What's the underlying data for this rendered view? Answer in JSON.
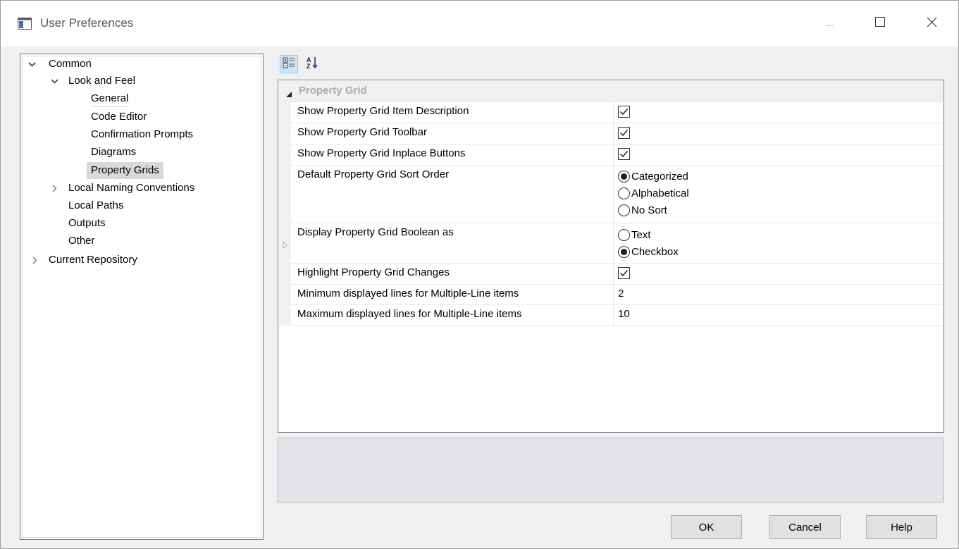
{
  "window": {
    "title": "User Preferences",
    "controls": {
      "minimize": "minimize-icon",
      "maximize": "maximize-icon",
      "close": "close-icon"
    }
  },
  "tree": {
    "common": "Common",
    "look_and_feel": "Look and Feel",
    "general": "General",
    "code_editor": "Code Editor",
    "confirmation_prompts": "Confirmation Prompts",
    "diagrams": "Diagrams",
    "property_grids": "Property Grids",
    "local_naming_conventions": "Local Naming Conventions",
    "local_paths": "Local Paths",
    "outputs": "Outputs",
    "other": "Other",
    "current_repository": "Current Repository",
    "selected": "Property Grids"
  },
  "toolbar": {
    "categorized_icon": "categorized-icon",
    "alphabetical_icon": "sort-az-icon"
  },
  "grid": {
    "category": "Property Grid",
    "rows": [
      {
        "name": "Show Property Grid Item Description",
        "type": "checkbox",
        "checked": true
      },
      {
        "name": "Show Property Grid Toolbar",
        "type": "checkbox",
        "checked": true
      },
      {
        "name": "Show Property Grid Inplace Buttons",
        "type": "checkbox",
        "checked": true
      },
      {
        "name": "Default Property Grid Sort Order",
        "type": "radio",
        "options": [
          "Categorized",
          "Alphabetical",
          "No Sort"
        ],
        "selected": "Categorized"
      },
      {
        "name": "Display Property Grid Boolean as",
        "type": "radio",
        "options": [
          "Text",
          "Checkbox"
        ],
        "selected": "Checkbox"
      },
      {
        "name": "Highlight Property Grid Changes",
        "type": "checkbox",
        "checked": true
      },
      {
        "name": "Minimum displayed lines for Multiple-Line items",
        "type": "text",
        "value": "2"
      },
      {
        "name": "Maximum displayed lines for Multiple-Line items",
        "type": "text",
        "value": "10"
      }
    ]
  },
  "buttons": {
    "ok": "OK",
    "cancel": "Cancel",
    "help": "Help"
  }
}
